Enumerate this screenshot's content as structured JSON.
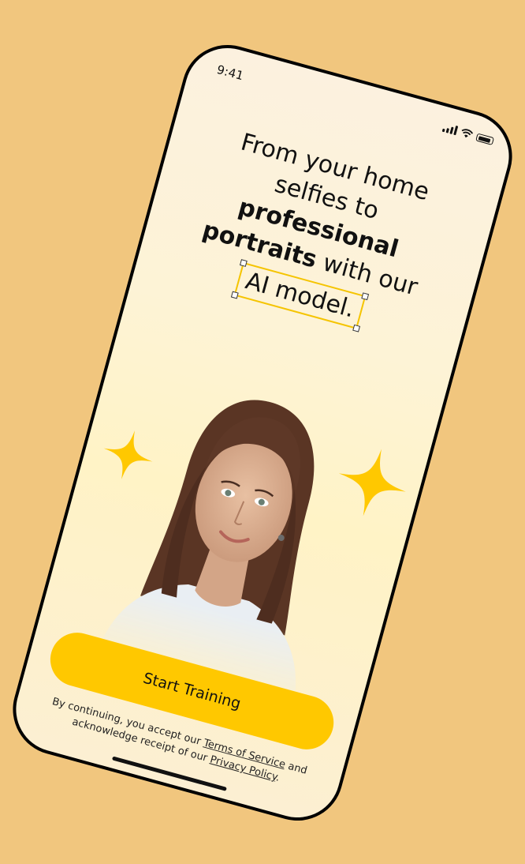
{
  "status_bar": {
    "time": "9:41",
    "icons": [
      "cellular-signal-icon",
      "wifi-icon",
      "battery-icon"
    ]
  },
  "headline": {
    "line1": "From your home",
    "line2": "selfies to",
    "bold1": "professional",
    "bold2": "portraits",
    "line3_rest": " with our",
    "boxed": "AI model."
  },
  "hero": {
    "portrait": "woman-portrait-photo",
    "sparkles": [
      "sparkle-icon",
      "sparkle-icon"
    ]
  },
  "cta": {
    "label": "Start Training"
  },
  "legal": {
    "prefix": "By continuing, you accept our ",
    "terms_link": "Terms of Service",
    "middle": " and acknowledge receipt of our ",
    "privacy_link": "Privacy Policy",
    "suffix": "."
  },
  "colors": {
    "background": "#F1C67E",
    "accent": "#FFC800",
    "selection_box": "#F5C400",
    "text": "#111111"
  }
}
